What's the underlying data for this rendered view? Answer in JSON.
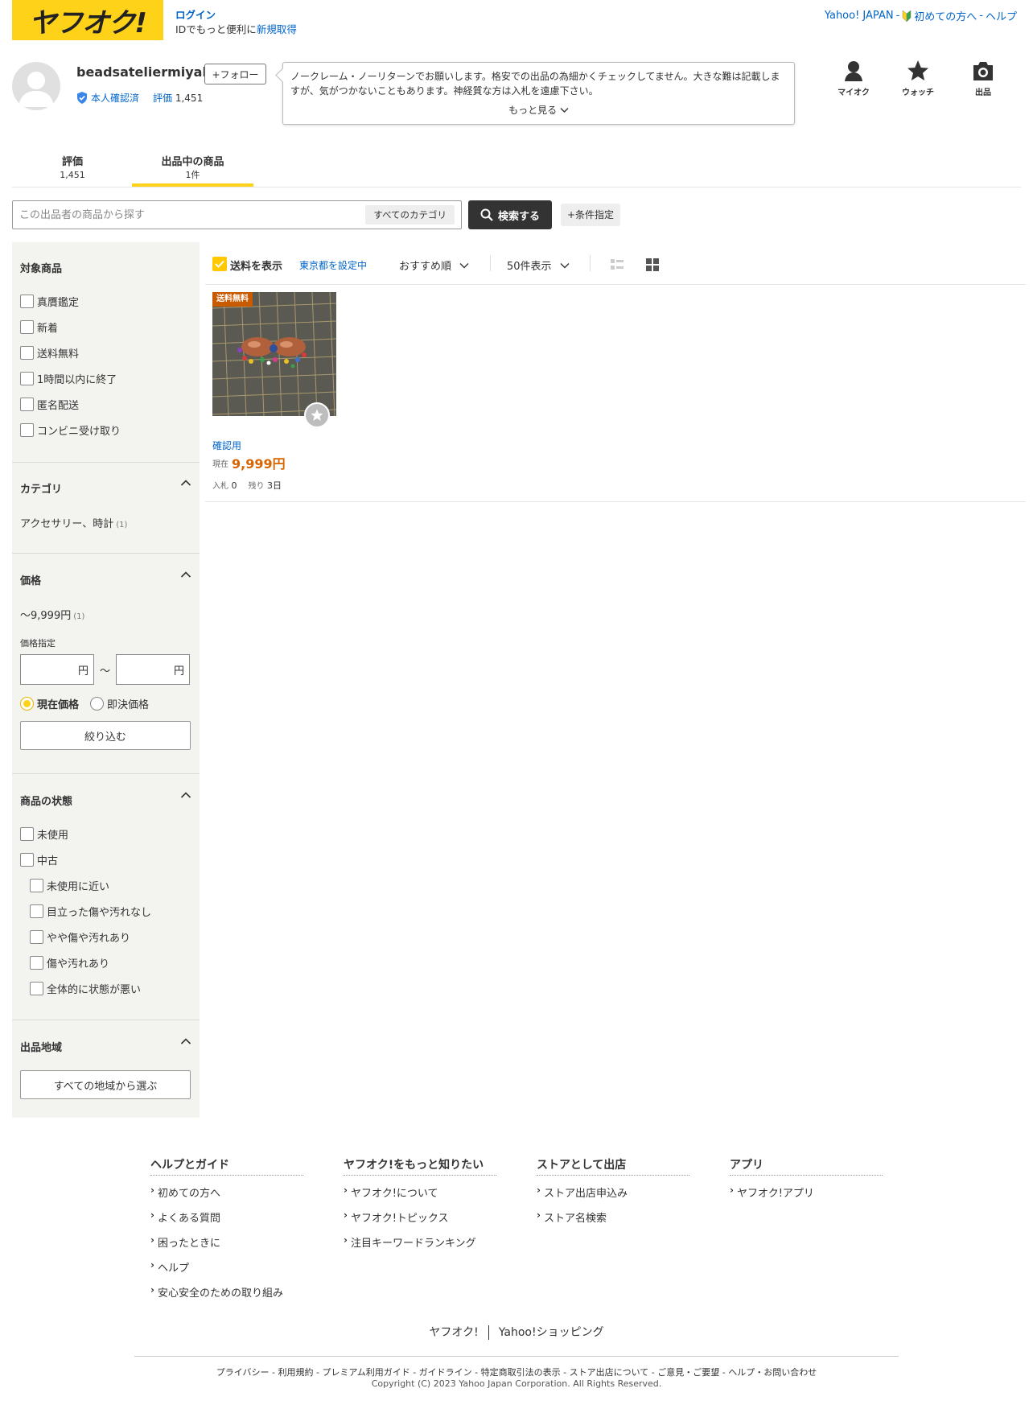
{
  "header": {
    "logo_text": "ヤフオク!",
    "login_label": "ログイン",
    "login_note": "IDでもっと便利に",
    "register_label": "新規取得",
    "top_links": {
      "yahoo_japan": "Yahoo! JAPAN",
      "sep1": "-",
      "first_time": "初めての方へ",
      "sep2": "-",
      "help": "ヘルプ"
    }
  },
  "profile": {
    "seller_name": "beadsateliermiyabi",
    "follow_label": "+フォロー",
    "verified_label": "本人確認済",
    "rating_label": "評価",
    "rating_value": "1,451",
    "comment": "ノークレーム・ノーリターンでお願いします。格安での出品の為細かくチェックしてません。大きな難は記載しますが、気がつかないこともあります。神経質な方は入札を遠慮下さい。",
    "more_label": "もっと見る"
  },
  "top_icons": {
    "myauc": "マイオク",
    "watch": "ウォッチ",
    "sell": "出品"
  },
  "tabs": [
    {
      "label": "評価",
      "sub": "1,451"
    },
    {
      "label": "出品中の商品",
      "sub": "1件"
    }
  ],
  "search": {
    "placeholder": "この出品者の商品から探す",
    "category": "すべてのカテゴリ",
    "button": "検索する",
    "conditions": "+条件指定"
  },
  "sidebar": {
    "target": {
      "title": "対象商品",
      "items": [
        "真贋鑑定",
        "新着",
        "送料無料",
        "1時間以内に終了",
        "匿名配送",
        "コンビニ受け取り"
      ]
    },
    "category": {
      "title": "カテゴリ",
      "item": "アクセサリー、時計",
      "count": "(1)"
    },
    "price": {
      "title": "価格",
      "range": "〜9,999円",
      "count": "(1)",
      "specify_label": "価格指定",
      "unit": "円",
      "tilde": "〜",
      "radio_current": "現在価格",
      "radio_buynow": "即決価格",
      "apply": "絞り込む"
    },
    "condition": {
      "title": "商品の状態",
      "unused": "未使用",
      "used": "中古",
      "sub_items": [
        "未使用に近い",
        "目立った傷や汚れなし",
        "やや傷や汚れあり",
        "傷や汚れあり",
        "全体的に状態が悪い"
      ]
    },
    "region": {
      "title": "出品地域",
      "button": "すべての地域から選ぶ"
    }
  },
  "toolbar": {
    "show_shipping": "送料を表示",
    "location": "東京都を設定中",
    "sort": "おすすめ順",
    "per_page": "50件表示"
  },
  "item": {
    "badge": "送料無料",
    "title": "確認用",
    "price_label": "現在",
    "price": "9,999円",
    "bids_label": "入札",
    "bids": "0",
    "remaining_label": "残り",
    "remaining": "3日"
  },
  "footer": {
    "columns": [
      {
        "title": "ヘルプとガイド",
        "links": [
          "初めての方へ",
          "よくある質問",
          "困ったときに",
          "ヘルプ",
          "安心安全のための取り組み"
        ]
      },
      {
        "title": "ヤフオク!をもっと知りたい",
        "links": [
          "ヤフオク!について",
          "ヤフオク!トピックス",
          "注目キーワードランキング"
        ]
      },
      {
        "title": "ストアとして出店",
        "links": [
          "ストア出店申込み",
          "ストア名検索"
        ]
      },
      {
        "title": "アプリ",
        "links": [
          "ヤフオク!アプリ"
        ]
      }
    ],
    "brand1": "ヤフオク!",
    "brand2": "Yahoo!ショッピング",
    "links": "プライバシー - 利用規約 - プレミアム利用ガイド - ガイドライン - 特定商取引法の表示 - ストア出店について - ご意見・ご要望 - ヘルプ・お問い合わせ",
    "copyright": "Copyright (C) 2023 Yahoo Japan Corporation. All Rights Reserved."
  },
  "colors": {
    "brand_yellow": "#ffd21a",
    "link_blue": "#0064c8",
    "price_orange": "#d86400",
    "badge_brown": "#c85a00"
  }
}
